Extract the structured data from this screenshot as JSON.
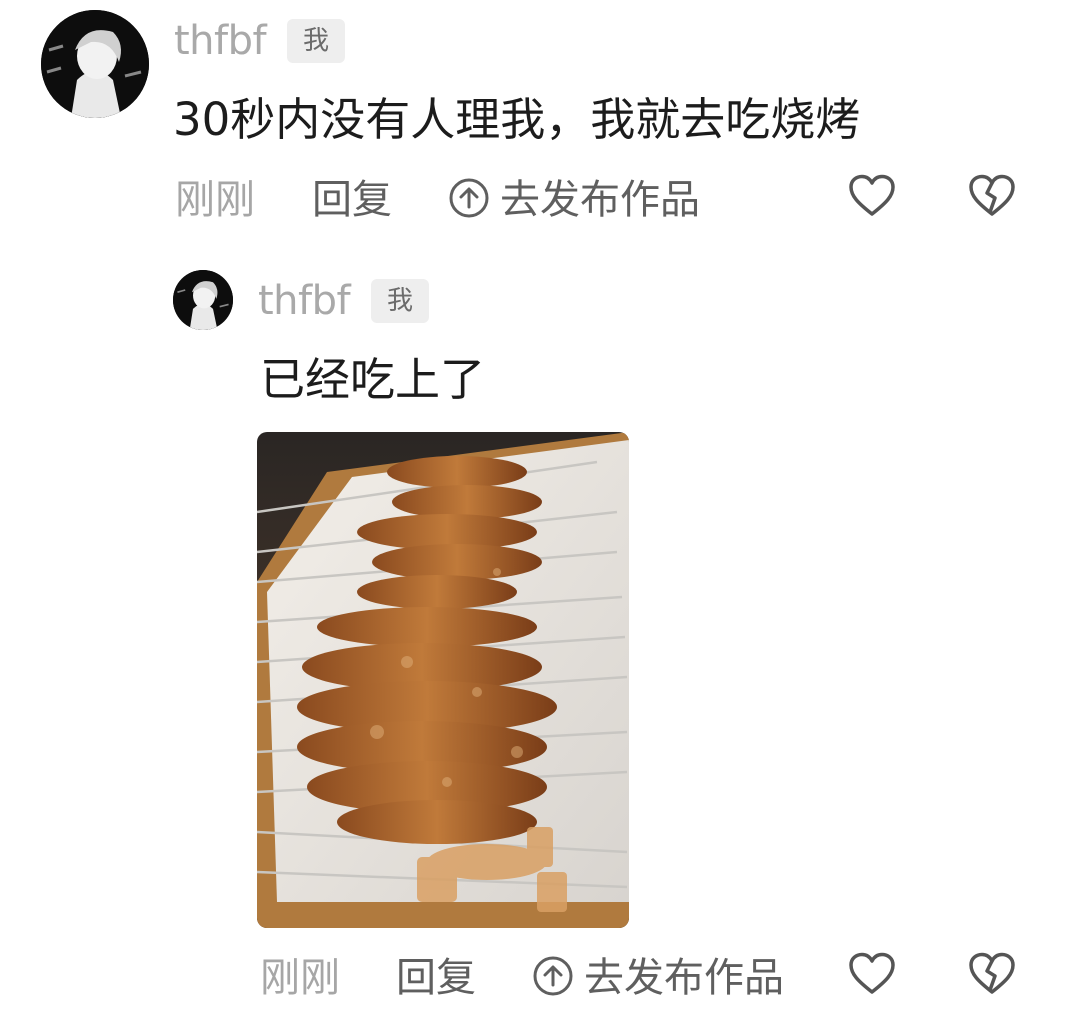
{
  "comments": [
    {
      "username": "thfbf",
      "badge": "我",
      "text": "30秒内没有人理我，我就去吃烧烤",
      "time": "刚刚",
      "reply_label": "回复",
      "publish_label": "去发布作品"
    },
    {
      "username": "thfbf",
      "badge": "我",
      "text": "已经吃上了",
      "time": "刚刚",
      "reply_label": "回复",
      "publish_label": "去发布作品"
    }
  ],
  "colors": {
    "username": "#a9a9a9",
    "meta": "#a6a6a6",
    "action": "#5f5f5f",
    "text": "#1c1c1c",
    "badge_bg": "#eeeeee"
  },
  "icons": [
    "publish-upload-icon",
    "heart-icon",
    "broken-heart-icon"
  ]
}
